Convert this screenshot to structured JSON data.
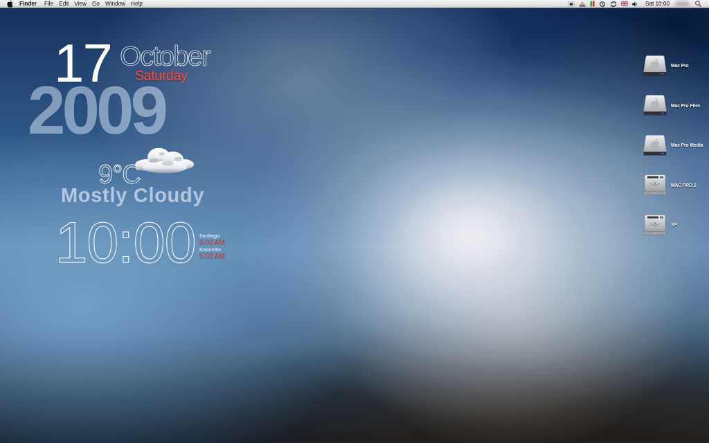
{
  "menu_bar": {
    "app_name": "Finder",
    "menus": [
      "File",
      "Edit",
      "View",
      "Go",
      "Window",
      "Help"
    ],
    "clock": "Sat 10:00"
  },
  "date_widget": {
    "year": "2009",
    "day": "17",
    "month": "October",
    "weekday": "Saturday"
  },
  "weather_widget": {
    "temperature": "9°C",
    "condition": "Mostly Cloudy"
  },
  "clock_widget": {
    "time": "10:00",
    "world_clocks": [
      {
        "city": "Santiago",
        "time": "6:00 AM"
      },
      {
        "city": "Knoxville",
        "time": "5:00 AM"
      }
    ]
  },
  "desktop_icons": [
    {
      "label": "Mac Pro",
      "kind": "apple-drive"
    },
    {
      "label": "Mac Pro Files",
      "kind": "apple-drive"
    },
    {
      "label": "Mac Pro Media",
      "kind": "apple-drive"
    },
    {
      "label": "MAC PRO 2",
      "kind": "hard-drive"
    },
    {
      "label": "XP",
      "kind": "hard-drive"
    }
  ]
}
